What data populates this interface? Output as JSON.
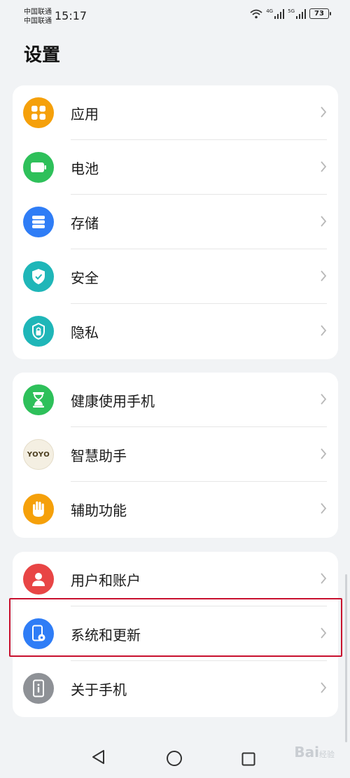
{
  "status_bar": {
    "carrier_1": "中国联通",
    "carrier_2": "中国联通",
    "time": "15:17",
    "net_1": "4G",
    "net_2": "5G",
    "battery": "73"
  },
  "page": {
    "title": "设置"
  },
  "groups": [
    {
      "items": [
        {
          "label": "应用",
          "icon": "apps-icon",
          "color": "#f5a00a"
        },
        {
          "label": "电池",
          "icon": "battery-icon",
          "color": "#2ec05a"
        },
        {
          "label": "存储",
          "icon": "storage-icon",
          "color": "#2f7df6"
        },
        {
          "label": "安全",
          "icon": "shield-icon",
          "color": "#1fb6b8"
        },
        {
          "label": "隐私",
          "icon": "lock-icon",
          "color": "#1fb6b8"
        }
      ]
    },
    {
      "items": [
        {
          "label": "健康使用手机",
          "icon": "hourglass-icon",
          "color": "#2ec05a"
        },
        {
          "label": "智慧助手",
          "icon": "yoyo-icon",
          "color": "#f4efe2",
          "icon_text": "YOYO"
        },
        {
          "label": "辅助功能",
          "icon": "hand-icon",
          "color": "#f5a00a"
        }
      ]
    },
    {
      "items": [
        {
          "label": "用户和账户",
          "icon": "user-icon",
          "color": "#e84545"
        },
        {
          "label": "系统和更新",
          "icon": "system-update-icon",
          "color": "#2f7df6"
        },
        {
          "label": "关于手机",
          "icon": "about-phone-icon",
          "color": "#8e9196"
        }
      ]
    }
  ],
  "highlight_color": "#c8102e",
  "watermark": {
    "brand": "Bai",
    "suffix": "经验"
  }
}
